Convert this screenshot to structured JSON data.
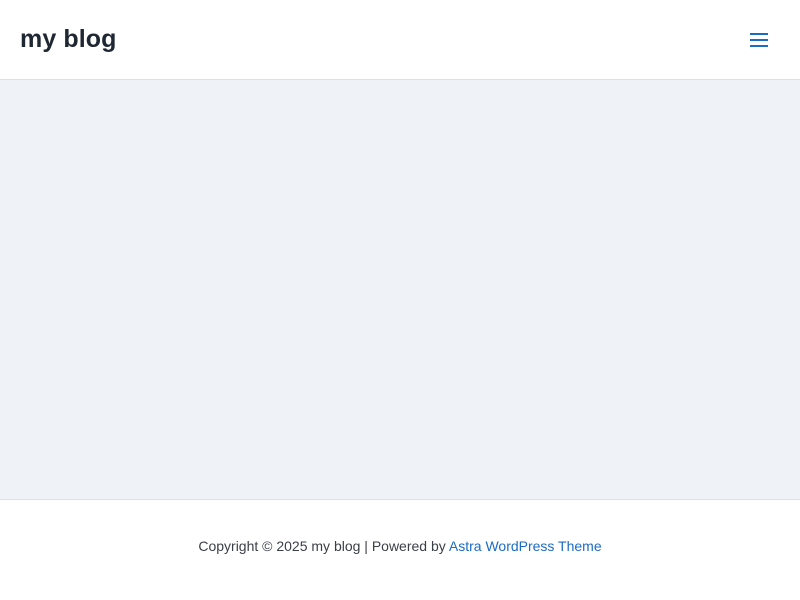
{
  "header": {
    "site_title": "my blog",
    "menu_icon": "hamburger-menu-icon",
    "accent_color": "#1b6cc4"
  },
  "footer": {
    "copyright": "Copyright © 2025 my blog | Powered by ",
    "theme_link": "Astra WordPress Theme"
  },
  "colors": {
    "content_background": "#eff3f8",
    "title_color": "#1f2733",
    "link_color": "#1b6cc4"
  }
}
